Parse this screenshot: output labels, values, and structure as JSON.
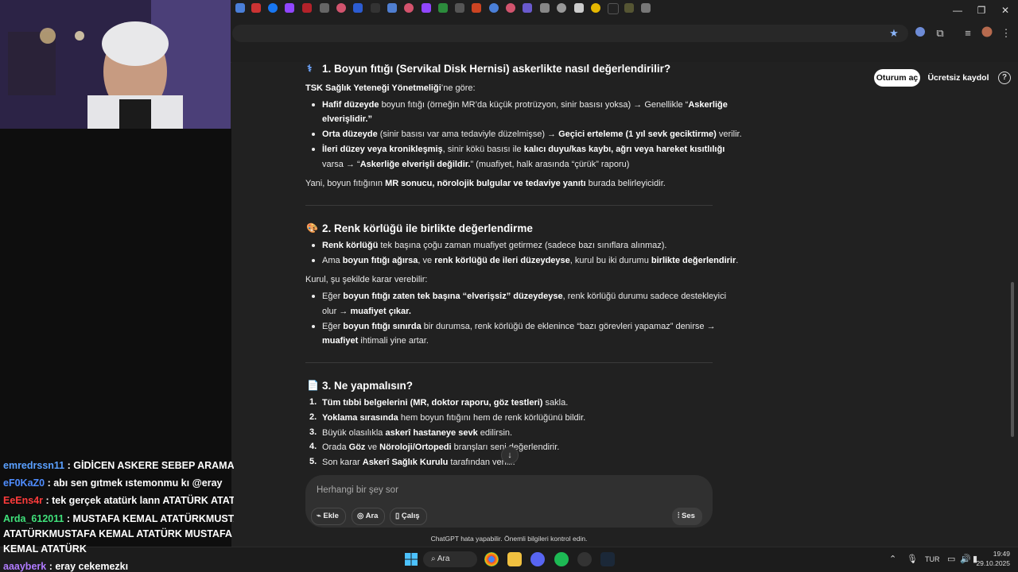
{
  "window": {
    "minimize": "—",
    "maximize": "❐",
    "close": "✕"
  },
  "header": {
    "login_button": "Oturum aç",
    "signup_button": "Ücretsiz kaydol",
    "help": "?"
  },
  "content": {
    "section1": {
      "icon": "⚕",
      "heading": "1. Boyun fıtığı (Servikal Disk Hernisi) askerlikte nasıl değerlendirilir?",
      "intro_bold": "TSK Sağlık Yeteneği Yönetmeliği",
      "intro_rest": "’ne göre:",
      "b1_bold": "Hafif düzeyde",
      "b1_text": " boyun fıtığı (örneğin MR’da küçük protrüzyon, sinir basısı yoksa) → Genellikle “",
      "b1_bold2": "Askerliğe",
      "b1_line2": "elverişlidir.”",
      "b2_bold": "Orta düzeyde",
      "b2_text": " (sinir basısı var ama tedaviyle düzelmişse) → ",
      "b2_bold2": "Geçici erteleme (1 yıl sevk geciktirme)",
      "b2_text2": " verilir.",
      "b3_bold": "İleri düzey veya kronikleşmiş",
      "b3_text": ", sinir kökü basısı ile ",
      "b3_bold2": "kalıcı duyu/kas kaybı, ağrı veya hareket kısıtlılığı",
      "b3_line2_a": "varsa → “",
      "b3_line2_bold": "Askerliğe elverişli değildir.",
      "b3_line2_b": "” (muafiyet, halk arasında “çürük” raporu)",
      "summary_a": "Yani, boyun fıtığının ",
      "summary_bold": "MR sonucu, nörolojik bulgular ve tedaviye yanıtı",
      "summary_b": " burada belirleyicidir."
    },
    "section2": {
      "icon": "🎨",
      "heading": "2. Renk körlüğü ile birlikte değerlendirme",
      "b1_bold": "Renk körlüğü",
      "b1_text": " tek başına çoğu zaman muafiyet getirmez (sadece bazı sınıflara alınmaz).",
      "b2_a": "Ama ",
      "b2_bold": "boyun fıtığı ağırsa",
      "b2_b": ", ve ",
      "b2_bold2": "renk körlüğü de ileri düzeydeyse",
      "b2_c": ", kurul bu iki durumu ",
      "b2_bold3": "birlikte değerlendirir",
      "b2_d": ".",
      "kurul": "Kurul, şu şekilde karar verebilir:",
      "b3_a": "Eğer ",
      "b3_bold": "boyun fıtığı zaten tek başına “elverişsiz” düzeydeyse",
      "b3_b": ", renk körlüğü durumu sadece destekleyici",
      "b3_line2_a": "olur → ",
      "b3_line2_bold": "muafiyet çıkar.",
      "b4_a": "Eğer ",
      "b4_bold": "boyun fıtığı sınırda",
      "b4_b": " bir durumsa, renk körlüğü de eklenince “bazı görevleri yapamaz” denirse →",
      "b4_line2_bold": "muafiyet",
      "b4_line2_b": " ihtimali yine artar."
    },
    "section3": {
      "icon": "📄",
      "heading": "3. Ne yapmalısın?",
      "items": [
        {
          "num": "1.",
          "bold": "Tüm tıbbi belgelerini (MR, doktor raporu, göz testleri)",
          "rest": " sakla."
        },
        {
          "num": "2.",
          "bold": "Yoklama sırasında",
          "rest": " hem boyun fıtığını hem de renk körlüğünü bildir."
        },
        {
          "num": "3.",
          "pre": "Büyük olasılıkla ",
          "bold": "askerî hastaneye sevk",
          "rest": " edilirsin."
        },
        {
          "num": "4.",
          "pre": "Orada ",
          "bold": "Göz",
          "rest": " ve ",
          "bold2": "Nöroloji/Ortopedi",
          "rest2": " branşları seni değerlendirir."
        },
        {
          "num": "5.",
          "pre": "Son karar ",
          "bold": "Askerî Sağlık Kurulu",
          "rest": " tarafından verilir."
        }
      ]
    }
  },
  "composer": {
    "placeholder": "Herhangi bir şey sor",
    "add_button": "Ekle",
    "search_button": "Ara",
    "study_button": "Çalış",
    "voice_button": "Ses",
    "disclaimer": "ChatGPT hata yapabilir. Önemli bilgileri kontrol edin."
  },
  "chat": [
    {
      "user": "emredrssn11",
      "color": "#5aa0ff",
      "message": " : GİDİCEN ASKERE SEBEP ARAMA"
    },
    {
      "user": "eF0KaZ0",
      "color": "#4f8dff",
      "message": " : abı sen gıtmek ıstemonmu kı @eray"
    },
    {
      "user": "EeEns4r",
      "color": "#ff3b3b",
      "message": " : tek gerçek atatürk lann ATATÜRK ATATÜ"
    },
    {
      "user": "Arda_612011",
      "color": "#3fe07a",
      "message": " : MUSTAFA KEMAL ATATÜRKMUSTA"
    },
    {
      "user": "",
      "color": "#ffffff",
      "message": "ATATÜRKMUSTAFA KEMAL ATATÜRK MUSTAFA KE"
    },
    {
      "user": "",
      "color": "#ffffff",
      "message": "KEMAL ATATÜRK"
    },
    {
      "user": "aaayberk",
      "color": "#b07bff",
      "message": " : eray cekemezkı"
    }
  ],
  "taskbar": {
    "search": "Ara",
    "lang": "TUR",
    "time": "19:49",
    "date": "29.10.2025"
  },
  "colors": {
    "accent_blue": "#8ab4f8",
    "page_bg": "#212121",
    "composer_bg": "#303030"
  }
}
